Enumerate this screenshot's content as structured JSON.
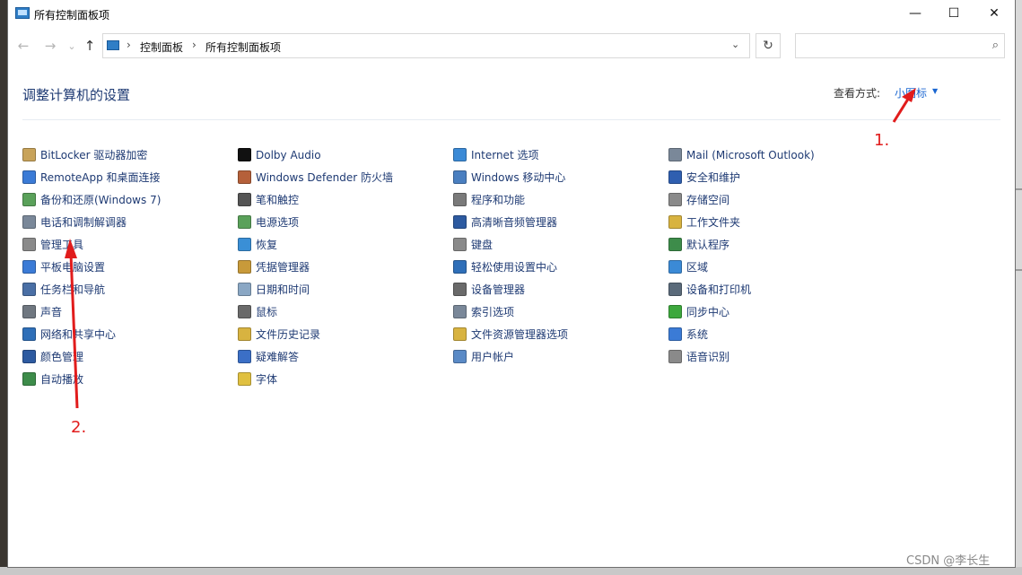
{
  "window": {
    "title": "所有控制面板项"
  },
  "navigation": {
    "back": "←",
    "forward": "→",
    "recent": "⌄",
    "up": "↑",
    "breadcrumb": [
      "控制面板",
      "所有控制面板项"
    ],
    "separator": "›",
    "dropdown": "⌄",
    "refresh": "↻",
    "search_placeholder": "",
    "search_icon": "⌕"
  },
  "header": {
    "title": "调整计算机的设置",
    "view_by_label": "查看方式:",
    "view_by_value": "小图标",
    "view_by_caret": "▼"
  },
  "window_buttons": {
    "minimize": "—",
    "maximize": "☐",
    "close": "✕"
  },
  "columns": [
    [
      {
        "label": "BitLocker 驱动器加密",
        "icon": "bitlocker-icon",
        "color": "#c8a35a"
      },
      {
        "label": "RemoteApp 和桌面连接",
        "icon": "remoteapp-icon",
        "color": "#3b7bd6"
      },
      {
        "label": "备份和还原(Windows 7)",
        "icon": "backup-icon",
        "color": "#5aa15a"
      },
      {
        "label": "电话和调制解调器",
        "icon": "phone-modem-icon",
        "color": "#7a8899"
      },
      {
        "label": "管理工具",
        "icon": "admin-tools-icon",
        "color": "#8a8a8a"
      },
      {
        "label": "平板电脑设置",
        "icon": "tablet-icon",
        "color": "#3b7bd6"
      },
      {
        "label": "任务栏和导航",
        "icon": "taskbar-icon",
        "color": "#4a6fa5"
      },
      {
        "label": "声音",
        "icon": "sound-icon",
        "color": "#6f7780"
      },
      {
        "label": "网络和共享中心",
        "icon": "network-icon",
        "color": "#2f6fb8"
      },
      {
        "label": "颜色管理",
        "icon": "color-mgmt-icon",
        "color": "#2d5aa0"
      },
      {
        "label": "自动播放",
        "icon": "autoplay-icon",
        "color": "#3d8c4a"
      }
    ],
    [
      {
        "label": "Dolby Audio",
        "icon": "dolby-icon",
        "color": "#111111"
      },
      {
        "label": "Windows Defender 防火墙",
        "icon": "firewall-icon",
        "color": "#b5603a"
      },
      {
        "label": "笔和触控",
        "icon": "pen-icon",
        "color": "#555555"
      },
      {
        "label": "电源选项",
        "icon": "power-icon",
        "color": "#5aa15a"
      },
      {
        "label": "恢复",
        "icon": "recovery-icon",
        "color": "#3a8fd6"
      },
      {
        "label": "凭据管理器",
        "icon": "credential-icon",
        "color": "#c89a3a"
      },
      {
        "label": "日期和时间",
        "icon": "datetime-icon",
        "color": "#8aa7c4"
      },
      {
        "label": "鼠标",
        "icon": "mouse-icon",
        "color": "#6a6a6a"
      },
      {
        "label": "文件历史记录",
        "icon": "file-history-icon",
        "color": "#d8b340"
      },
      {
        "label": "疑难解答",
        "icon": "troubleshoot-icon",
        "color": "#3b6fc6"
      },
      {
        "label": "字体",
        "icon": "font-icon",
        "color": "#e0c040"
      }
    ],
    [
      {
        "label": "Internet 选项",
        "icon": "internet-icon",
        "color": "#3b8ad6"
      },
      {
        "label": "Windows 移动中心",
        "icon": "mobility-icon",
        "color": "#4a7fc0"
      },
      {
        "label": "程序和功能",
        "icon": "programs-icon",
        "color": "#7a7a7a"
      },
      {
        "label": "高清晰音频管理器",
        "icon": "audio-manager-icon",
        "color": "#2d5aa0"
      },
      {
        "label": "键盘",
        "icon": "keyboard-icon",
        "color": "#8a8a8a"
      },
      {
        "label": "轻松使用设置中心",
        "icon": "ease-of-access-icon",
        "color": "#2f6fb8"
      },
      {
        "label": "设备管理器",
        "icon": "device-manager-icon",
        "color": "#6a6a6a"
      },
      {
        "label": "索引选项",
        "icon": "indexing-icon",
        "color": "#7a8899"
      },
      {
        "label": "文件资源管理器选项",
        "icon": "explorer-options-icon",
        "color": "#d8b340"
      },
      {
        "label": "用户帐户",
        "icon": "user-accounts-icon",
        "color": "#5a8ac6"
      }
    ],
    [
      {
        "label": "Mail (Microsoft Outlook)",
        "icon": "mail-icon",
        "color": "#7a8899"
      },
      {
        "label": "安全和维护",
        "icon": "security-flag-icon",
        "color": "#2f5fb0"
      },
      {
        "label": "存储空间",
        "icon": "storage-icon",
        "color": "#8a8a8a"
      },
      {
        "label": "工作文件夹",
        "icon": "work-folders-icon",
        "color": "#d8b340"
      },
      {
        "label": "默认程序",
        "icon": "default-programs-icon",
        "color": "#3d8c4a"
      },
      {
        "label": "区域",
        "icon": "region-icon",
        "color": "#3b8ad6"
      },
      {
        "label": "设备和打印机",
        "icon": "printer-icon",
        "color": "#5a6a7a"
      },
      {
        "label": "同步中心",
        "icon": "sync-icon",
        "color": "#3da83d"
      },
      {
        "label": "系统",
        "icon": "system-icon",
        "color": "#3b7bd6"
      },
      {
        "label": "语音识别",
        "icon": "speech-icon",
        "color": "#8a8a8a"
      }
    ]
  ],
  "annotations": {
    "one": "1.",
    "two": "2."
  },
  "watermark": "CSDN @李长生"
}
